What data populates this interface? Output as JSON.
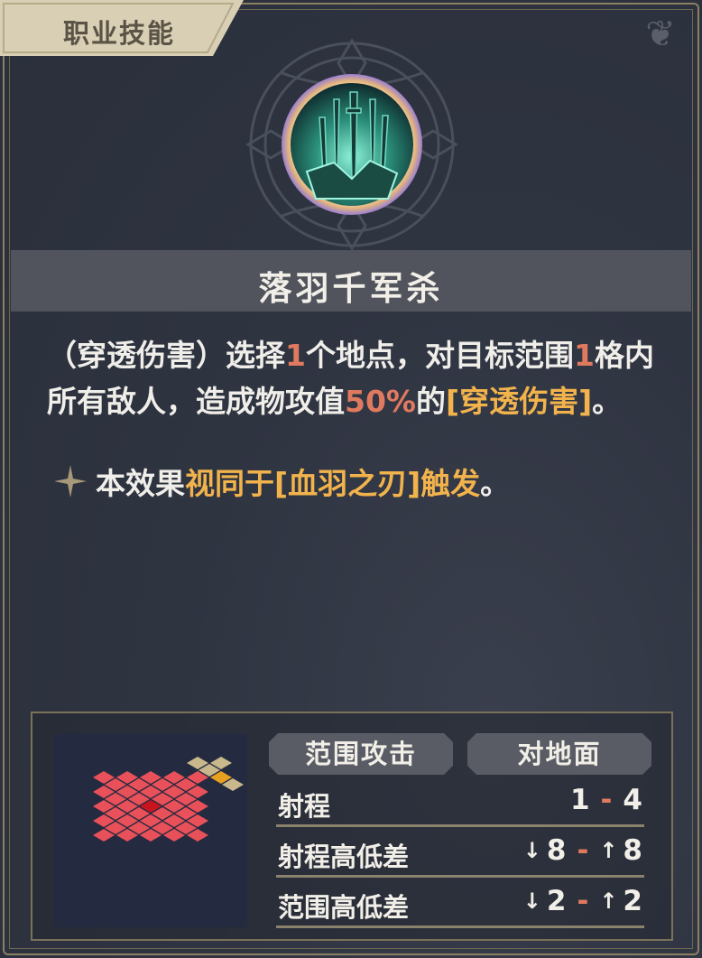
{
  "header": {
    "tab_label": "职业技能"
  },
  "skill": {
    "name": "落羽千军杀",
    "icon": "sword-rain-icon",
    "description": {
      "part1": "（穿透伤害）选择",
      "num1": "1",
      "part2": "个地点，对目标范围",
      "num2": "1",
      "part3": "格内所有敌人，造成物攻值",
      "pct": "50%",
      "part4": "的",
      "dmg_type": "[穿透伤害]",
      "part5": "。"
    },
    "note": {
      "prefix": "本效果",
      "highlight": "视同于[血羽之刃]触发",
      "suffix": "。"
    }
  },
  "stats": {
    "tags": [
      "范围攻击",
      "对地面"
    ],
    "rows": [
      {
        "label": "射程",
        "low": "1",
        "high": "4",
        "low_arrow": "",
        "high_arrow": ""
      },
      {
        "label": "射程高低差",
        "low": "8",
        "high": "8",
        "low_arrow": "↓",
        "high_arrow": "↑"
      },
      {
        "label": "范围高低差",
        "low": "2",
        "high": "2",
        "low_arrow": "↓",
        "high_arrow": "↑"
      }
    ]
  },
  "colors": {
    "accent_number": "#e07a5f",
    "accent_gold": "#f2b34c",
    "range_tile": "#e8505a",
    "center_tile": "#c8141e",
    "target_tile": "#e8a020",
    "neutral_tile": "#c8b88c"
  }
}
